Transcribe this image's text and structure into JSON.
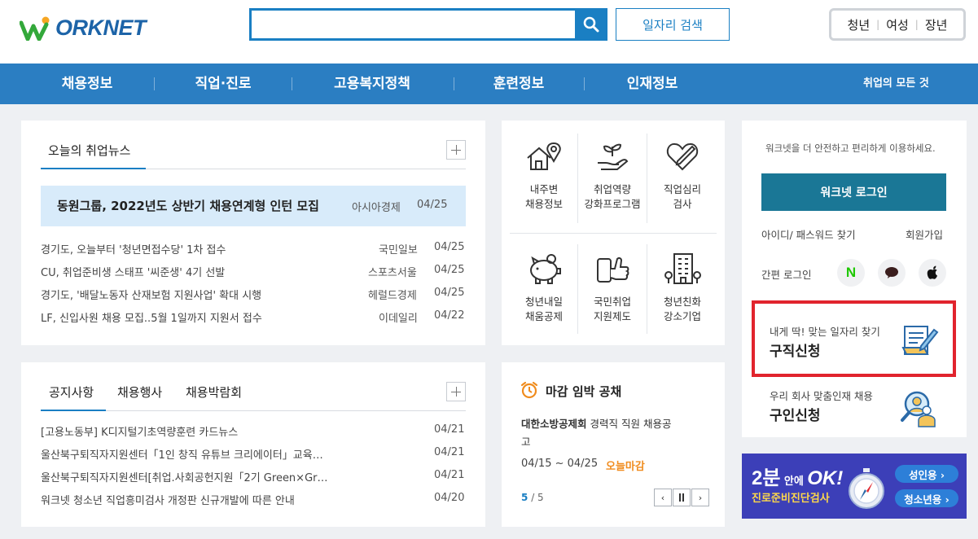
{
  "header": {
    "logo_text": "WORKNET",
    "search": {
      "value": "",
      "placeholder": ""
    },
    "job_search_button": "일자리 검색",
    "target_links": [
      "청년",
      "여성",
      "장년"
    ]
  },
  "gnb": {
    "items": [
      "채용정보",
      "직업·진로",
      "고용복지정책",
      "훈련정보",
      "인재정보"
    ],
    "all_menu": "취업의 모든 것"
  },
  "news": {
    "tab": "오늘의 취업뉴스",
    "headline": {
      "title": "동원그룹, 2022년도 상반기 채용연계형 인턴 모집",
      "source": "아시아경제",
      "date": "04/25"
    },
    "items": [
      {
        "title": "경기도, 오늘부터 '청년면접수당' 1차 접수",
        "source": "국민일보",
        "date": "04/25"
      },
      {
        "title": "CU, 취업준비생 스태프 '씨준생' 4기 선발",
        "source": "스포츠서울",
        "date": "04/25"
      },
      {
        "title": "경기도, '배달노동자 산재보험 지원사업' 확대 시행",
        "source": "헤럴드경제",
        "date": "04/25"
      },
      {
        "title": "LF, 신입사원 채용 모집..5월 1일까지 지원서 접수",
        "source": "이데일리",
        "date": "04/22"
      }
    ]
  },
  "services": {
    "row1": [
      {
        "icon": "house-pin-icon",
        "line1": "내주변",
        "line2": "채용정보"
      },
      {
        "icon": "hand-sprout-icon",
        "line1": "취업역량",
        "line2": "강화프로그램"
      },
      {
        "icon": "heart-pen-icon",
        "line1": "직업심리",
        "line2": "검사"
      }
    ],
    "row2": [
      {
        "icon": "piggy-bank-icon",
        "line1": "청년내일",
        "line2": "채움공제"
      },
      {
        "icon": "thumbs-up-phone-icon",
        "line1": "국민취업",
        "line2": "지원제도"
      },
      {
        "icon": "building-icon",
        "line1": "청년친화",
        "line2": "강소기업"
      }
    ]
  },
  "login": {
    "intro": "워크넷을 더 안전하고 편리하게 이용하세요.",
    "button": "워크넷 로그인",
    "find": "아이디/ 패스워드 찾기",
    "join": "회원가입",
    "easy_login": "간편 로그인",
    "naver_letter": "N"
  },
  "notice": {
    "tabs": [
      "공지사항",
      "채용행사",
      "채용박람회"
    ],
    "items": [
      {
        "title": "[고용노동부] K디지털기초역량훈련 카드뉴스",
        "date": "04/21"
      },
      {
        "title": "울산북구퇴직자지원센터「1인 창직 유튜브 크리에이터」교육…",
        "date": "04/21"
      },
      {
        "title": "울산북구퇴직자지원센터[취업.사회공헌지원「2기 Green×Gr…",
        "date": "04/21"
      },
      {
        "title": "워크넷 청소년 직업흥미검사 개정판 신규개발에 따른 안내",
        "date": "04/20"
      }
    ]
  },
  "deadline": {
    "title": "마감 임박 공채",
    "company": "대한소방공제회",
    "job_line1": "경력직 직원 채용공",
    "job_line2": "고",
    "period": "04/15 ~ 04/25",
    "badge": "오늘마감",
    "page_current": "5",
    "page_total": "/ 5"
  },
  "apply": {
    "jobseeker_sub": "내게 딱! 맞는 일자리 찾기",
    "jobseeker_title": "구직신청",
    "employer_sub": "우리 회사 맞춤인재 채용",
    "employer_title": "구인신청"
  },
  "banner": {
    "big": "2분",
    "mid": "안에",
    "ok": "OK!",
    "sub": "진로준비진단검사",
    "adult_btn": "성인용 ›",
    "youth_btn": "청소년용 ›"
  },
  "colors": {
    "primary": "#2b7ec2",
    "search_border": "#1a7fc3",
    "login_btn": "#1a7796",
    "headline_bg": "#d8ebfa",
    "highlight_red": "#e1242d",
    "deadline_orange": "#f08c1e",
    "banner_bg": "#3c3fb8"
  }
}
